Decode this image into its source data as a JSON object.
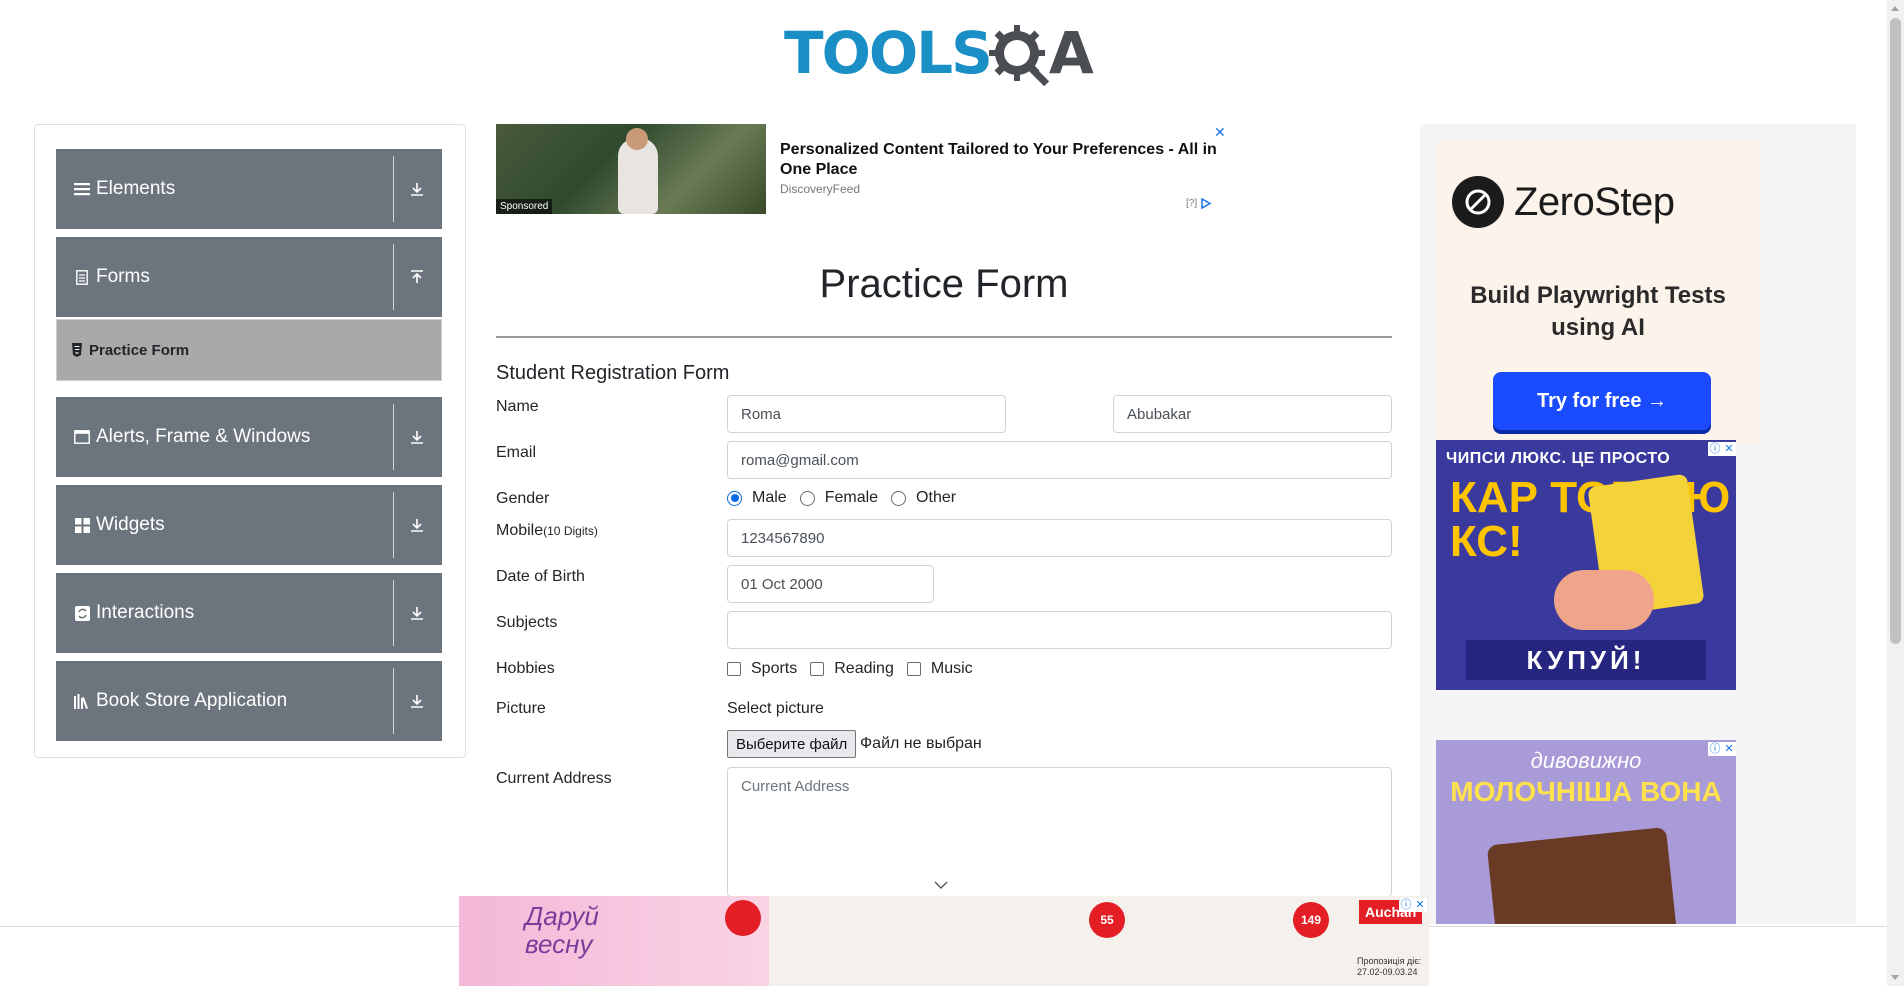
{
  "logo": {
    "part1": "TOOLS",
    "part2": "A"
  },
  "sidebar": {
    "groups": [
      {
        "label": "Elements",
        "icon": "hamburger-icon",
        "arrow": "download-arrow-icon"
      },
      {
        "label": "Forms",
        "icon": "document-icon",
        "arrow": "upload-arrow-icon"
      },
      {
        "label": "Alerts, Frame & Windows",
        "icon": "window-icon",
        "arrow": "download-arrow-icon"
      },
      {
        "label": "Widgets",
        "icon": "grid-icon",
        "arrow": "download-arrow-icon"
      },
      {
        "label": "Interactions",
        "icon": "refresh-icon",
        "arrow": "download-arrow-icon"
      },
      {
        "label": "Book Store Application",
        "icon": "books-icon",
        "arrow": "download-arrow-icon"
      }
    ],
    "active_item": "Practice Form"
  },
  "ad_top": {
    "headline": "Personalized Content Tailored to Your Preferences - All in One Place",
    "source": "DiscoveryFeed",
    "sponsored": "Sponsored",
    "close": "✕",
    "adchoices": "[?]"
  },
  "form": {
    "page_title": "Practice Form",
    "title": "Student Registration Form",
    "labels": {
      "name": "Name",
      "email": "Email",
      "gender": "Gender",
      "mobile": "Mobile",
      "mobile_hint": "(10 Digits)",
      "dob": "Date of Birth",
      "subjects": "Subjects",
      "hobbies": "Hobbies",
      "picture": "Picture",
      "address": "Current Address"
    },
    "first_name": "Roma",
    "last_name": "Abubakar",
    "email": "roma@gmail.com",
    "gender_options": [
      "Male",
      "Female",
      "Other"
    ],
    "gender_selected": "Male",
    "mobile": "1234567890",
    "dob": "01 Oct 2000",
    "subjects": "",
    "hobbies": [
      "Sports",
      "Reading",
      "Music"
    ],
    "picture_prompt": "Select picture",
    "file_button": "Выберите файл",
    "file_status": "Файл не выбран",
    "address_placeholder": "Current Address"
  },
  "ads_right": {
    "zerostep": {
      "name": "ZeroStep",
      "tagline": "Build Playwright Tests using AI",
      "cta": "Try for free →"
    },
    "chips": {
      "top": "ЧИПСИ ЛЮКС. ЦЕ ПРОСТО",
      "big": "КАР ТОП ЛЮ КС!",
      "buy": "КУПУЙ!"
    },
    "milka": {
      "line1": "дивовижно",
      "line2": "МОЛОЧНІША ВОНА"
    }
  },
  "ad_bottom": {
    "promo": "Даруй весну",
    "brand": "Auchan",
    "prices": [
      "55",
      "149"
    ],
    "period_label": "Пропозиція діє:",
    "dates": "27.02-09.03.24"
  },
  "colors": {
    "sidebar_bg": "#6c757d",
    "active_bg": "#a9a9a9",
    "logo_blue": "#1a8fc6",
    "radio_blue": "#0b6ce8",
    "cta_blue": "#1a4bff"
  }
}
